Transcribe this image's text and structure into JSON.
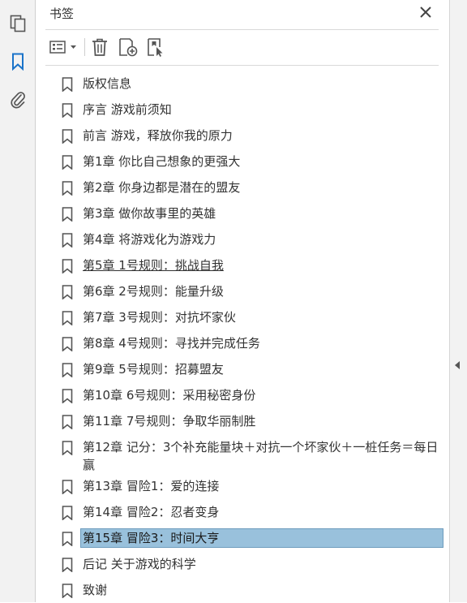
{
  "panel": {
    "title": "书签",
    "close_label": "✕"
  },
  "bookmarks": [
    {
      "label": "版权信息"
    },
    {
      "label": "序言 游戏前须知"
    },
    {
      "label": "前言 游戏，释放你我的原力"
    },
    {
      "label": "第1章 你比自己想象的更强大"
    },
    {
      "label": "第2章 你身边都是潜在的盟友"
    },
    {
      "label": "第3章 做你故事里的英雄"
    },
    {
      "label": "第4章 将游戏化为游戏力"
    },
    {
      "label": "第5章 1号规则：挑战自我"
    },
    {
      "label": "第6章 2号规则：能量升级"
    },
    {
      "label": "第7章 3号规则：对抗坏家伙"
    },
    {
      "label": "第8章 4号规则：寻找并完成任务"
    },
    {
      "label": "第9章 5号规则：招募盟友"
    },
    {
      "label": "第10章 6号规则：采用秘密身份"
    },
    {
      "label": "第11章 7号规则：争取华丽制胜"
    },
    {
      "label": "第12章 记分：3个补充能量块＋对抗一个坏家伙＋一桩任务＝每日赢"
    },
    {
      "label": "第13章 冒险1：爱的连接"
    },
    {
      "label": "第14章 冒险2：忍者变身"
    },
    {
      "label": "第15章 冒险3：时间大亨"
    },
    {
      "label": "后记 关于游戏的科学"
    },
    {
      "label": "致谢"
    }
  ],
  "colors": {
    "accent": "#1a73c9",
    "selection": "#99c1dc"
  },
  "icons": [
    "pages-icon",
    "bookmark-icon",
    "attachment-icon",
    "options-menu-icon",
    "trash-icon",
    "new-bookmark-icon",
    "bookmark-from-selection-icon",
    "close-icon"
  ]
}
